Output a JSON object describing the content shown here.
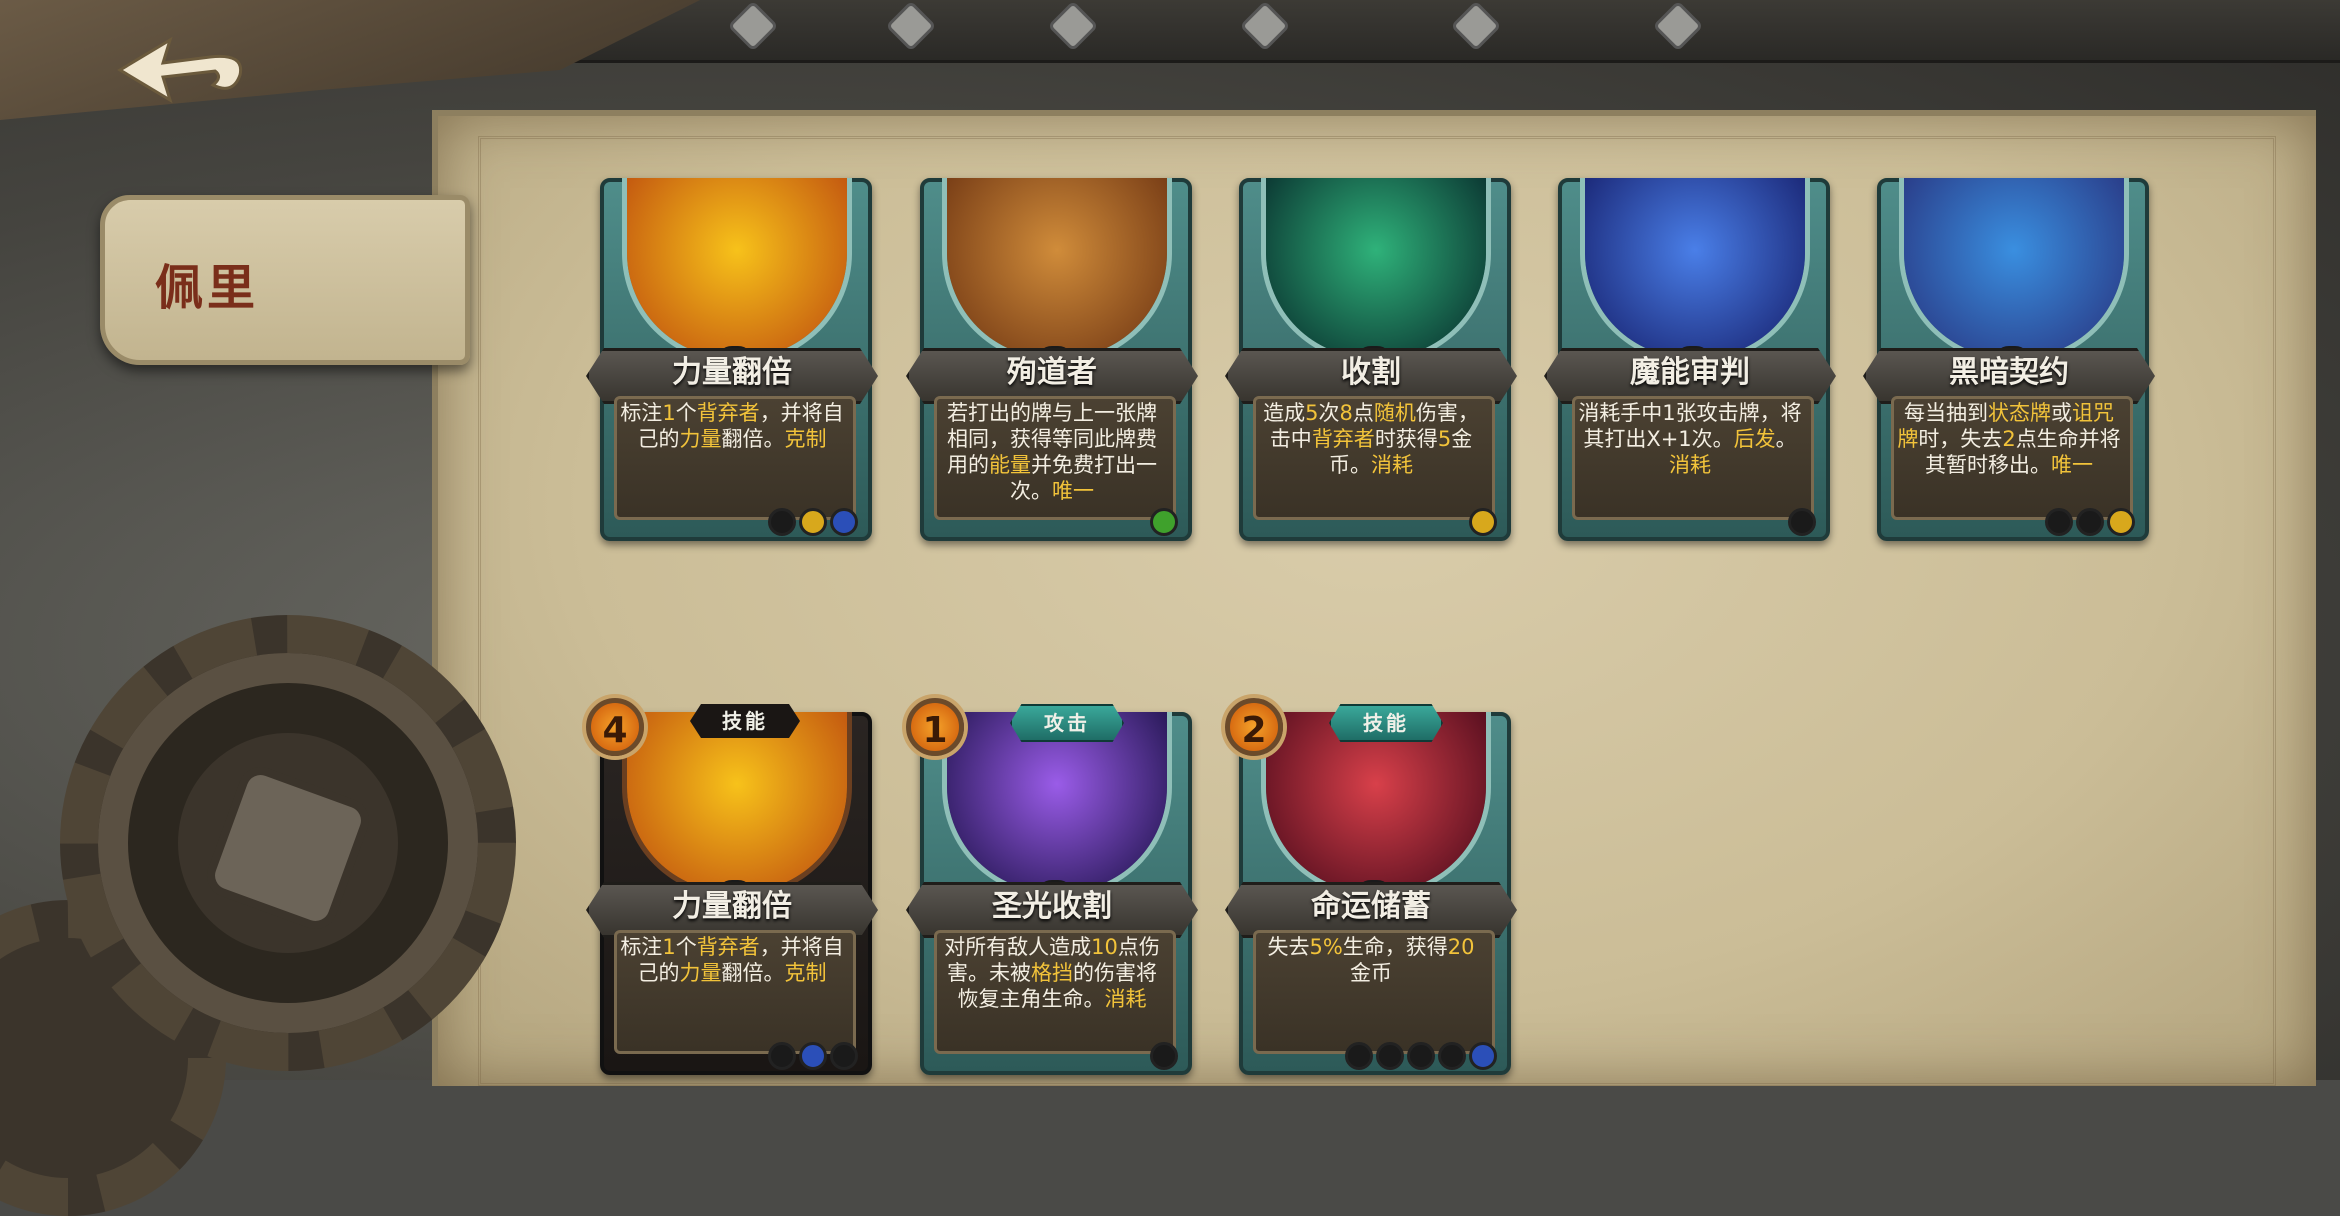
{
  "header": {
    "back_icon": "back-arrow-icon"
  },
  "character": {
    "name": "佩里"
  },
  "top_cards": [
    {
      "name": "力量翻倍",
      "desc": [
        "标注",
        {
          "t": "1",
          "h": true
        },
        "个",
        {
          "t": "背弃者",
          "h": true
        },
        "，并将自己的",
        {
          "t": "力量",
          "h": true
        },
        "翻倍。",
        {
          "t": "克制",
          "h": true
        }
      ],
      "gem": "#8e44c7",
      "art": [
        "#f7c21a",
        "#c45a10"
      ],
      "slots": [
        "#1a1a1a",
        "#d8a81c",
        "#2b4fb8"
      ]
    },
    {
      "name": "殉道者",
      "desc": [
        "若打出的牌与上一张牌相同，获得等同此牌费用的",
        {
          "t": "能量",
          "h": true
        },
        "并免费打出一次。",
        {
          "t": "唯一",
          "h": true
        }
      ],
      "gem": "#2a8fd8",
      "art": [
        "#d08c3a",
        "#7a3f17"
      ],
      "slots": [
        "#3fa12c"
      ]
    },
    {
      "name": "收割",
      "desc": [
        "造成",
        {
          "t": "5",
          "h": true
        },
        "次",
        {
          "t": "8",
          "h": true
        },
        "点",
        {
          "t": "随机",
          "h": true
        },
        "伤害，击中",
        {
          "t": "背弃者",
          "h": true
        },
        "时获得",
        {
          "t": "5",
          "h": true
        },
        "金币。",
        {
          "t": "消耗",
          "h": true
        }
      ],
      "gem": "#2a8fd8",
      "art": [
        "#2fb27a",
        "#0c3a34"
      ],
      "slots": [
        "#d8a81c"
      ]
    },
    {
      "name": "魔能审判",
      "desc": [
        "消耗手中1张攻击牌，将其打出X+1次。",
        {
          "t": "后发",
          "h": true
        },
        "。",
        {
          "t": "消耗",
          "h": true
        }
      ],
      "gem": "#2a8fd8",
      "art": [
        "#4a7fe8",
        "#1c2a7a"
      ],
      "slots": [
        "#1a1a1a"
      ]
    },
    {
      "name": "黑暗契约",
      "desc": [
        "每当抽到",
        {
          "t": "状态牌",
          "h": true
        },
        "或",
        {
          "t": "诅咒牌",
          "h": true
        },
        "时，失去",
        {
          "t": "2",
          "h": true
        },
        "点生命并将其暂时移出。",
        {
          "t": "唯一",
          "h": true
        }
      ],
      "gem": "#2a8fd8",
      "art": [
        "#3a8fe0",
        "#2a3e8a"
      ],
      "slots": [
        "#1a1a1a",
        "#1a1a1a",
        "#d8a81c"
      ]
    }
  ],
  "bottom_cards": [
    {
      "cost": "4",
      "type": "技能",
      "dark": true,
      "name": "力量翻倍",
      "desc": [
        "标注",
        {
          "t": "1",
          "h": true
        },
        "个",
        {
          "t": "背弃者",
          "h": true
        },
        "，并将自己的",
        {
          "t": "力量",
          "h": true
        },
        "翻倍。",
        {
          "t": "克制",
          "h": true
        }
      ],
      "gem": "#8e44c7",
      "art": [
        "#f7c21a",
        "#c45a10"
      ],
      "slots": [
        "#1a1a1a",
        "#2b4fb8",
        "#1a1a1a"
      ]
    },
    {
      "cost": "1",
      "type": "攻击",
      "dark": false,
      "name": "圣光收割",
      "desc": [
        "对所有敌人造成",
        {
          "t": "10",
          "h": true
        },
        "点伤害。未被",
        {
          "t": "格挡",
          "h": true
        },
        "的伤害将恢复主角生命。",
        {
          "t": "消耗",
          "h": true
        }
      ],
      "gem": "#d8a81c",
      "art": [
        "#9a5ce8",
        "#2a1a5a"
      ],
      "slots": [
        "#1a1a1a"
      ]
    },
    {
      "cost": "2",
      "type": "技能",
      "dark": false,
      "name": "命运储蓄",
      "desc": [
        "失去",
        {
          "t": "5%",
          "h": true
        },
        "生命，获得",
        {
          "t": "20",
          "h": true
        },
        "金币"
      ],
      "gem": "#2a8fd8",
      "art": [
        "#d8404a",
        "#5a1020"
      ],
      "slots": [
        "#1a1a1a",
        "#1a1a1a",
        "#1a1a1a",
        "#1a1a1a",
        "#2b4fb8"
      ]
    }
  ]
}
